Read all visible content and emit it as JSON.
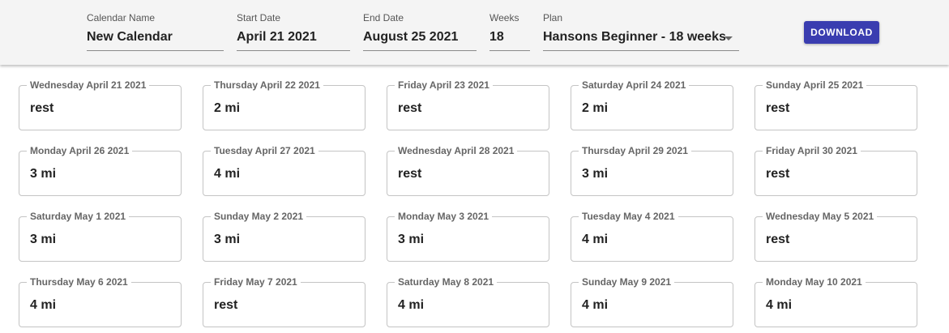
{
  "header": {
    "calendar_name": {
      "label": "Calendar Name",
      "value": "New Calendar"
    },
    "start_date": {
      "label": "Start Date",
      "value": "April 21 2021"
    },
    "end_date": {
      "label": "End Date",
      "value": "August 25 2021"
    },
    "weeks": {
      "label": "Weeks",
      "value": "18"
    },
    "plan": {
      "label": "Plan",
      "value": "Hansons Beginner - 18 weeks",
      "icon": "chevron-down-icon"
    },
    "download_label": "DOWNLOAD"
  },
  "days": [
    {
      "date": "Wednesday April 21 2021",
      "workout": "rest"
    },
    {
      "date": "Thursday April 22 2021",
      "workout": "2 mi"
    },
    {
      "date": "Friday April 23 2021",
      "workout": "rest"
    },
    {
      "date": "Saturday April 24 2021",
      "workout": "2 mi"
    },
    {
      "date": "Sunday April 25 2021",
      "workout": "rest"
    },
    {
      "date": "Monday April 26 2021",
      "workout": "3 mi"
    },
    {
      "date": "Tuesday April 27 2021",
      "workout": "4 mi"
    },
    {
      "date": "Wednesday April 28 2021",
      "workout": "rest"
    },
    {
      "date": "Thursday April 29 2021",
      "workout": "3 mi"
    },
    {
      "date": "Friday April 30 2021",
      "workout": "rest"
    },
    {
      "date": "Saturday May 1 2021",
      "workout": "3 mi"
    },
    {
      "date": "Sunday May 2 2021",
      "workout": "3 mi"
    },
    {
      "date": "Monday May 3 2021",
      "workout": "3 mi"
    },
    {
      "date": "Tuesday May 4 2021",
      "workout": "4 mi"
    },
    {
      "date": "Wednesday May 5 2021",
      "workout": "rest"
    },
    {
      "date": "Thursday May 6 2021",
      "workout": "4 mi"
    },
    {
      "date": "Friday May 7 2021",
      "workout": "rest"
    },
    {
      "date": "Saturday May 8 2021",
      "workout": "4 mi"
    },
    {
      "date": "Sunday May 9 2021",
      "workout": "4 mi"
    },
    {
      "date": "Monday May 10 2021",
      "workout": "4 mi"
    }
  ],
  "colors": {
    "accent": "#3a3db0",
    "header_bg": "#f4f4f4"
  }
}
